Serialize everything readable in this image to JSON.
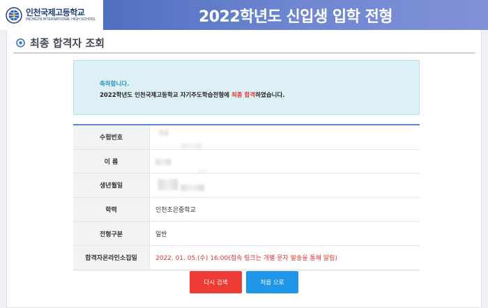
{
  "header": {
    "school_name_ko": "인천국제고등학교",
    "school_name_en": "INCHEON INTERNATIONAL HIGH SCHOOL",
    "title": "2022학년도 신입생 입학 전형",
    "bar_color_start": "#4f6fc0",
    "bar_color_end": "#8092d8"
  },
  "page": {
    "title": "최종 합격자 조회",
    "title_icon": "circle-bullet-icon"
  },
  "notice": {
    "congrats": "축하합니다.",
    "message_before": "2022학년도 인천국제고등학교 자기주도학습전형에 ",
    "message_highlight": "최종 합격",
    "message_after": "하였습니다.",
    "highlight_color": "#e53935"
  },
  "result_table": {
    "rows": [
      {
        "label": "수험번호",
        "value": ""
      },
      {
        "label": "이 름",
        "value": ""
      },
      {
        "label": "생년월일",
        "value": ""
      },
      {
        "label": "학력",
        "value": "인천초은중학교"
      },
      {
        "label": "전형구분",
        "value": "일반"
      },
      {
        "label": "합격자온라인소집일",
        "value": "2022. 01. 05.(수) 16:00(접속 링크는 개별 문자 발송을 통해 알림)"
      }
    ]
  },
  "buttons": {
    "search_again": "다시 검색",
    "home": "처음 으로",
    "search_again_color": "#ee3b35",
    "home_color": "#2196e8"
  }
}
